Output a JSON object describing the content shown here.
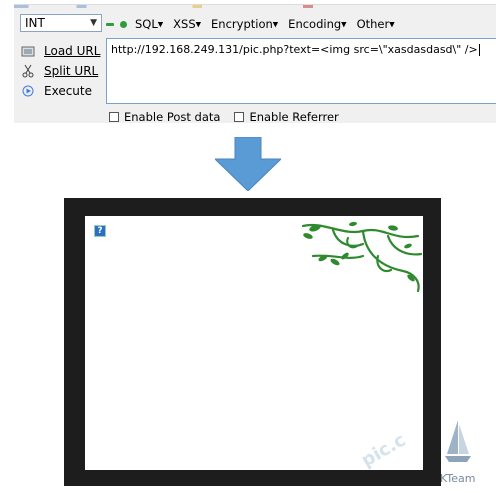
{
  "toolbar": {
    "sql_type": "INT",
    "menu": [
      {
        "label": "SQL",
        "name": "menu-sql"
      },
      {
        "label": "XSS",
        "name": "menu-xss"
      },
      {
        "label": "Encryption",
        "name": "menu-encryption"
      },
      {
        "label": "Encoding",
        "name": "menu-encoding"
      },
      {
        "label": "Other",
        "name": "menu-other"
      }
    ],
    "actions": {
      "load_url": "Load URL",
      "split_url": "Split URL",
      "execute": "Execute"
    },
    "url_value": "http://192.168.249.131/pic.php?text=<img src=\\\"xasdasdasd\\\" />",
    "enable_post": "Enable Post data",
    "enable_referrer": "Enable Referrer"
  },
  "result": {
    "broken_image_glyph": "?"
  },
  "watermark": {
    "team": "KTeam",
    "site": "pic.c"
  },
  "colors": {
    "arrow": "#5b9bd5",
    "frame": "#1d1d1d",
    "vine": "#2f8a2f"
  },
  "icons": [
    "load-url-icon",
    "split-url-icon",
    "execute-icon",
    "broken-image-icon",
    "down-arrow-icon"
  ]
}
